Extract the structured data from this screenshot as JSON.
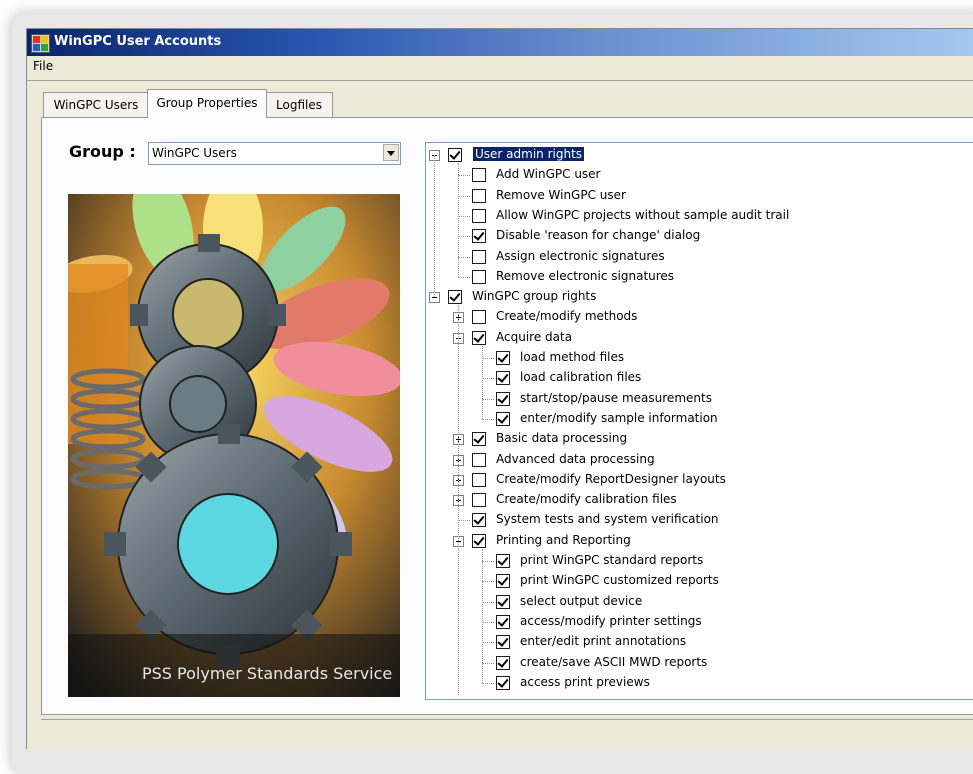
{
  "window": {
    "title": "WinGPC User Accounts"
  },
  "menu": {
    "file": "File"
  },
  "tabs": [
    {
      "label": "WinGPC Users"
    },
    {
      "label": "Group Properties"
    },
    {
      "label": "Logfiles"
    }
  ],
  "group": {
    "label": "Group :",
    "selected": "WinGPC Users"
  },
  "banner": {
    "text": "PSS Polymer Standards Service"
  },
  "tree": {
    "nodes": [
      {
        "label": "User admin rights",
        "checked": true,
        "level": 0,
        "expander": "minus",
        "selected": true
      },
      {
        "label": "Add WinGPC user",
        "checked": false,
        "level": 1
      },
      {
        "label": "Remove WinGPC user",
        "checked": false,
        "level": 1
      },
      {
        "label": "Allow WinGPC projects without sample audit trail",
        "checked": false,
        "level": 1
      },
      {
        "label": "Disable 'reason for change' dialog",
        "checked": true,
        "level": 1
      },
      {
        "label": "Assign electronic signatures",
        "checked": false,
        "level": 1
      },
      {
        "label": "Remove electronic signatures",
        "checked": false,
        "level": 1
      },
      {
        "label": "WinGPC group rights",
        "checked": true,
        "level": 0,
        "expander": "minus"
      },
      {
        "label": "Create/modify methods",
        "checked": false,
        "level": 1,
        "expander": "plus"
      },
      {
        "label": "Acquire data",
        "checked": true,
        "level": 1,
        "expander": "minus"
      },
      {
        "label": "load method files",
        "checked": true,
        "level": 2
      },
      {
        "label": "load calibration files",
        "checked": true,
        "level": 2
      },
      {
        "label": "start/stop/pause measurements",
        "checked": true,
        "level": 2
      },
      {
        "label": "enter/modify sample information",
        "checked": true,
        "level": 2
      },
      {
        "label": "Basic data processing",
        "checked": true,
        "level": 1,
        "expander": "plus"
      },
      {
        "label": "Advanced data processing",
        "checked": false,
        "level": 1,
        "expander": "plus"
      },
      {
        "label": "Create/modify ReportDesigner layouts",
        "checked": false,
        "level": 1,
        "expander": "plus"
      },
      {
        "label": "Create/modify calibration files",
        "checked": false,
        "level": 1,
        "expander": "plus"
      },
      {
        "label": "System tests and system verification",
        "checked": true,
        "level": 1
      },
      {
        "label": "Printing and Reporting",
        "checked": true,
        "level": 1,
        "expander": "minus"
      },
      {
        "label": "print WinGPC standard reports",
        "checked": true,
        "level": 2
      },
      {
        "label": "print WinGPC customized reports",
        "checked": true,
        "level": 2
      },
      {
        "label": "select output device",
        "checked": true,
        "level": 2
      },
      {
        "label": "access/modify printer settings",
        "checked": true,
        "level": 2
      },
      {
        "label": "enter/edit print annotations",
        "checked": true,
        "level": 2
      },
      {
        "label": "create/save ASCII MWD reports",
        "checked": true,
        "level": 2
      },
      {
        "label": "access print previews",
        "checked": true,
        "level": 2
      }
    ]
  }
}
